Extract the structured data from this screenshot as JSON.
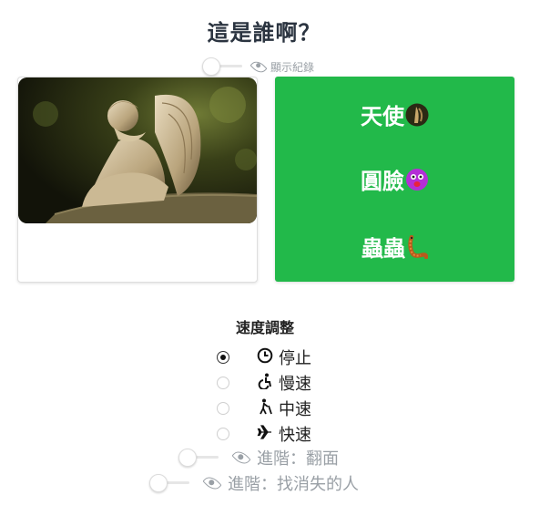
{
  "title": "這是誰啊？",
  "show_history": {
    "label": "顯示紀錄",
    "enabled": false
  },
  "answers": [
    {
      "text": "天使",
      "icon": "angel-statue-emoji"
    },
    {
      "text": "圓臉",
      "icon": "purple-face-emoji"
    },
    {
      "text": "蟲蟲",
      "icon": "worm-emoji"
    }
  ],
  "speed": {
    "title": "速度調整",
    "options": [
      {
        "label": "停止",
        "icon": "clock-icon",
        "selected": true
      },
      {
        "label": "慢速",
        "icon": "wheelchair-icon",
        "selected": false
      },
      {
        "label": "中速",
        "icon": "walking-person-icon",
        "selected": false
      },
      {
        "label": "快速",
        "icon": "airplane-icon",
        "selected": false
      }
    ]
  },
  "advanced": [
    {
      "label": "進階：翻面",
      "enabled": false
    },
    {
      "label": "進階：找消失的人",
      "enabled": false
    }
  ],
  "colors": {
    "answer_bg": "#22b94a",
    "title": "#2b3440",
    "muted": "#9aa0a6"
  }
}
